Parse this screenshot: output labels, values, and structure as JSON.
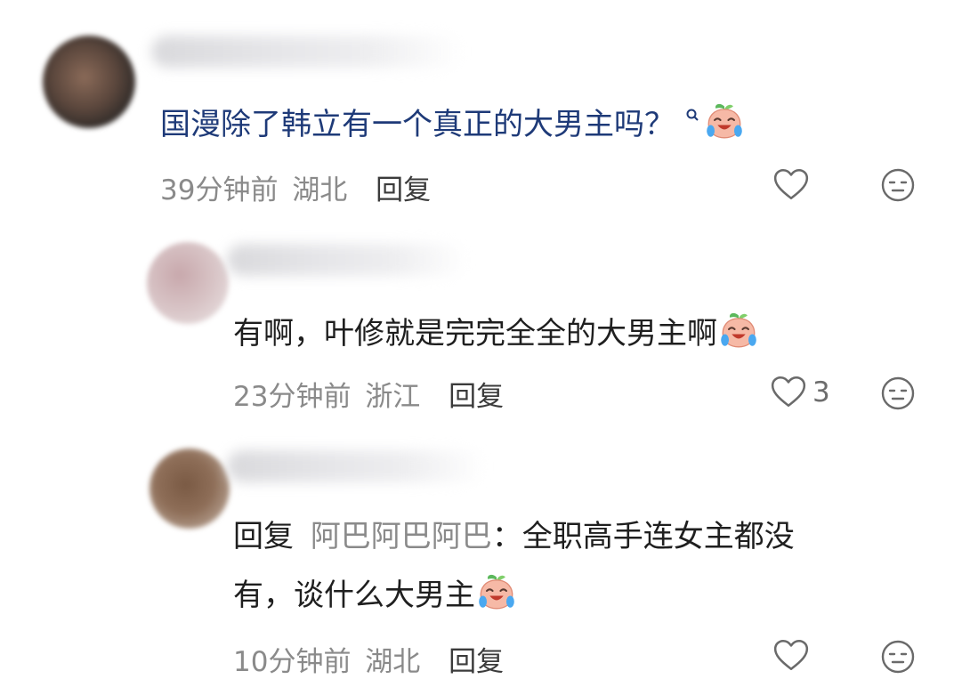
{
  "comments": [
    {
      "text": "国漫除了韩立有一个真正的大男主吗？",
      "time": "39分钟前",
      "location": "湖北",
      "reply_label": "回复",
      "likes": ""
    },
    {
      "text": "有啊，叶修就是完完全全的大男主啊",
      "time": "23分钟前",
      "location": "浙江",
      "reply_label": "回复",
      "likes": "3"
    },
    {
      "reply_prefix": "回复",
      "mention": "阿巴阿巴阿巴",
      "text_line1": "：全职高手连女主都没",
      "text_line2": "有，谈什么大男主",
      "time": "10分钟前",
      "location": "湖北",
      "reply_label": "回复",
      "likes": ""
    }
  ],
  "icons": {
    "like": "heart-outline-icon",
    "dislike": "neutral-face-icon",
    "emoji": "crying-laughing-peach-emoji"
  },
  "colors": {
    "main_text": "#1e3a78",
    "meta_text": "#8a8a8a"
  }
}
